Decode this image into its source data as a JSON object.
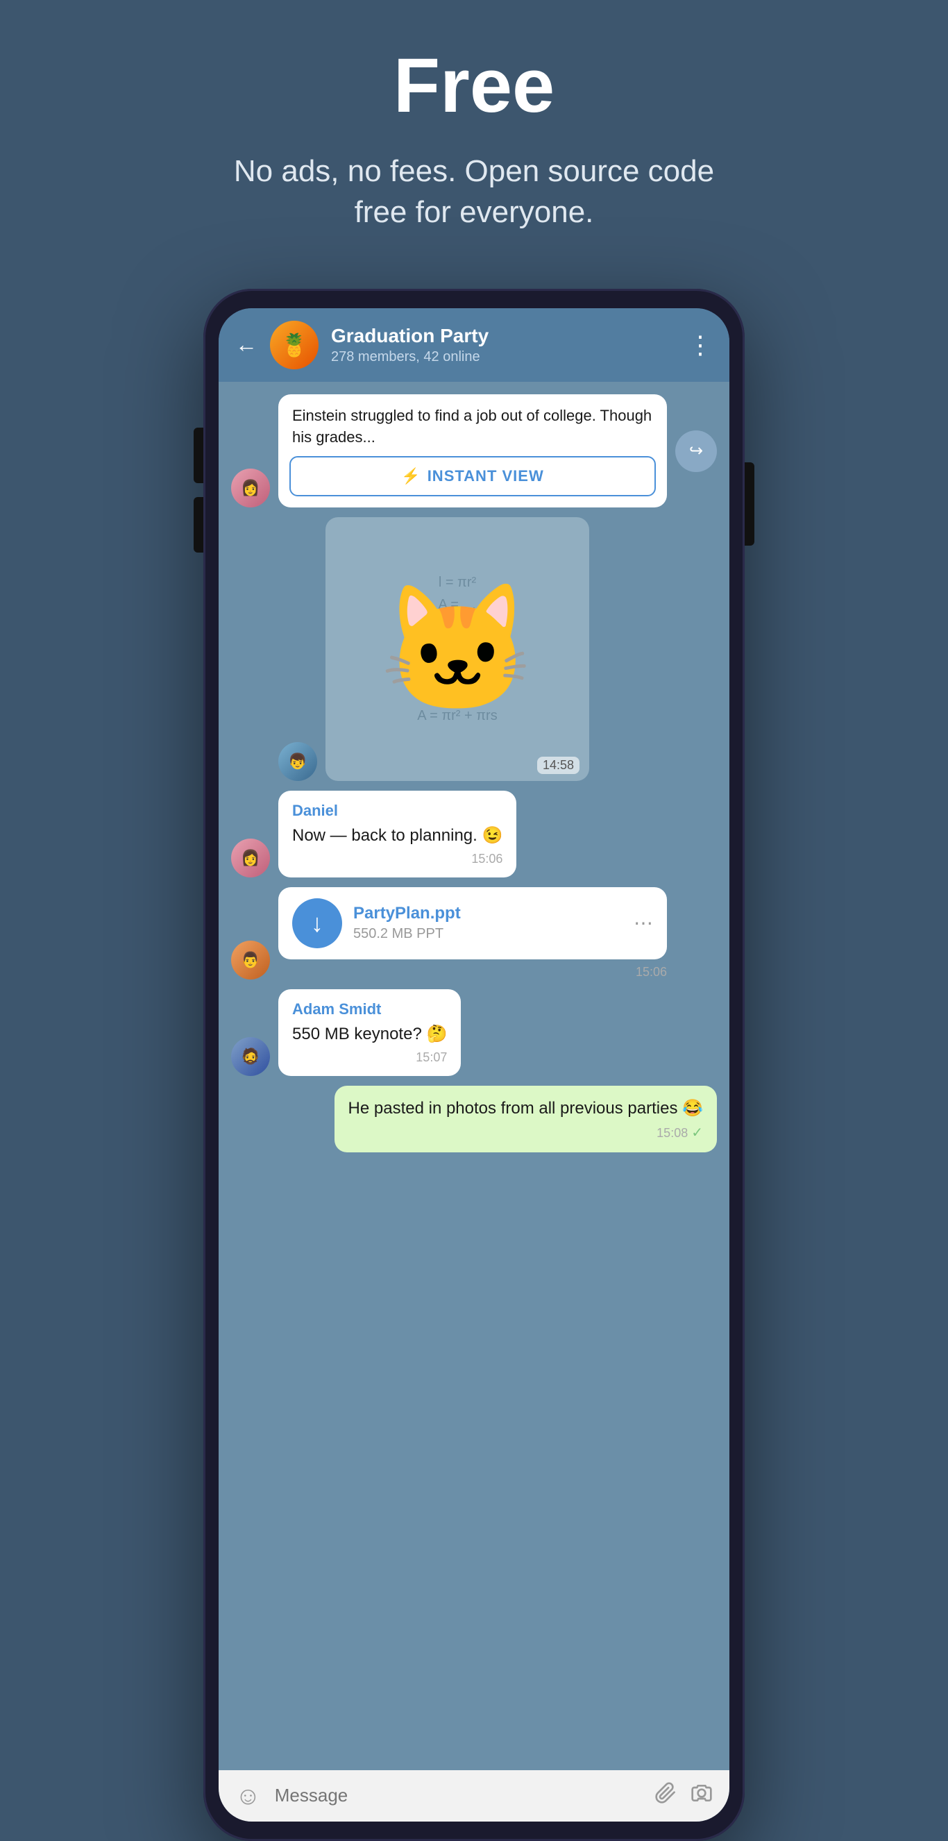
{
  "hero": {
    "title": "Free",
    "subtitle": "No ads, no fees. Open source code free for everyone."
  },
  "chat": {
    "group_name": "Graduation Party",
    "group_sub": "278 members, 42 online",
    "group_emoji": "🍍",
    "back_label": "←",
    "menu_dots": "⋮",
    "messages": [
      {
        "id": "article-msg",
        "type": "article",
        "text": "Einstein struggled to find a job out of college. Though his grades...",
        "iv_label": "INSTANT VIEW",
        "iv_lightning": "⚡",
        "share_icon": "↪"
      },
      {
        "id": "sticker-msg",
        "type": "sticker",
        "time": "14:58",
        "avatar_class": "av-man1",
        "avatar_emoji": "👤"
      },
      {
        "id": "daniel-msg",
        "type": "text",
        "sender": "Daniel",
        "text": "Now — back to planning. 😉",
        "time": "15:06",
        "avatar_class": "av-woman"
      },
      {
        "id": "file-msg",
        "type": "file",
        "file_name": "PartyPlan.ppt",
        "file_size": "550.2 MB PPT",
        "time": "15:06",
        "avatar_class": "av-man2"
      },
      {
        "id": "adam-msg",
        "type": "text",
        "sender": "Adam Smidt",
        "text": "550 MB keynote? 🤔",
        "time": "15:07",
        "avatar_class": "av-man3"
      },
      {
        "id": "own-msg",
        "type": "own",
        "text": "He pasted in photos from all previous parties 😂",
        "time": "15:08",
        "check": "✓"
      }
    ]
  },
  "input_bar": {
    "placeholder": "Message",
    "emoji_icon": "☺",
    "attach_icon": "📎",
    "camera_icon": "⊙"
  }
}
